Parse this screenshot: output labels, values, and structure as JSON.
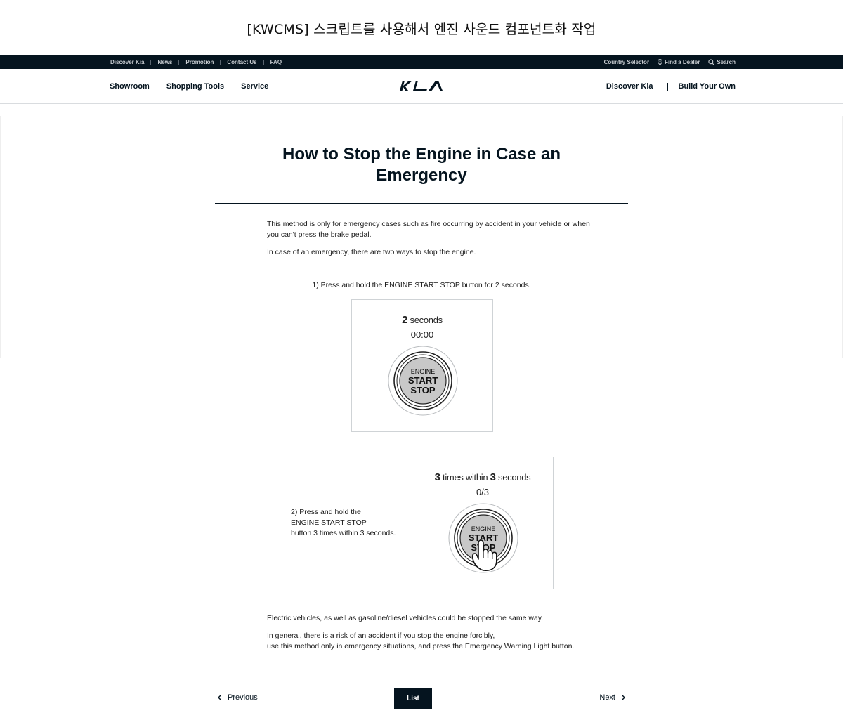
{
  "doc_title": "[KWCMS] 스크립트를 사용해서 엔진 사운드 컴포넌트화 작업",
  "utility_nav": {
    "links": [
      "Discover Kia",
      "News",
      "Promotion",
      "Contact Us",
      "FAQ"
    ],
    "country_selector": "Country Selector",
    "find_dealer": "Find a Dealer",
    "search": "Search"
  },
  "main_nav": {
    "left": [
      "Showroom",
      "Shopping Tools",
      "Service"
    ],
    "logo_alt": "KIA",
    "right": [
      "Discover Kia",
      "Build Your Own"
    ]
  },
  "article": {
    "title": "How to Stop the Engine in Case an Emergency",
    "intro_1": "This method is only for emergency cases such as fire occurring by accident in your vehicle or when you can't press the brake pedal.",
    "intro_2": "In case of an emergency,  there are two ways to stop the engine.",
    "step1": {
      "label": "1) Press and hold the ENGINE START STOP button for 2 seconds.",
      "head_num": "2",
      "head_text": " seconds",
      "counter": "00:00"
    },
    "step2": {
      "label_line1": "2) Press and hold the",
      "label_line2": "ENGINE START STOP",
      "label_line3": "button 3 times within 3 seconds.",
      "head_num1": "3",
      "head_mid": " times within ",
      "head_num2": "3",
      "head_end": " seconds",
      "counter": "0/3"
    },
    "button_text": {
      "line1": "ENGINE",
      "line2": "START",
      "line3": "STOP"
    },
    "note_1": "Electric vehicles, as well as gasoline/diesel vehicles could be stopped the same way.",
    "note_2_line1": "In general, there is a risk of an accident if you stop the engine forcibly,",
    "note_2_line2": "use this method only in emergency situations, and press the Emergency Warning Light button."
  },
  "pager": {
    "previous": "Previous",
    "list": "List",
    "next": "Next"
  },
  "colors": {
    "brand_dark": "#05141f",
    "button_fill": "#c8c8c8",
    "card_border": "#cfd3d6"
  }
}
